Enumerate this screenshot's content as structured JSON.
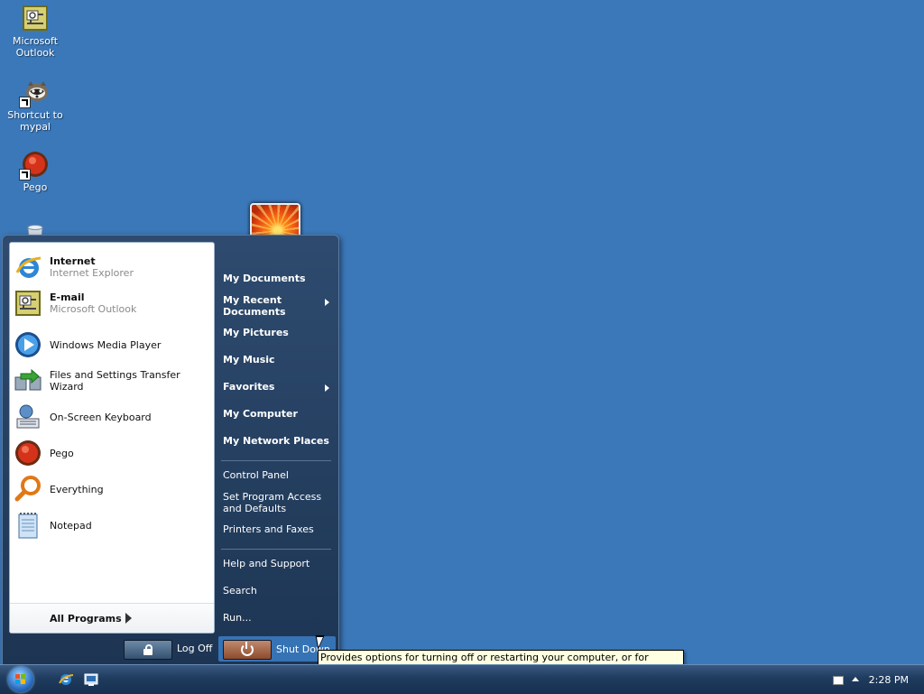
{
  "desktop": {
    "icons": [
      {
        "label": "Microsoft Outlook"
      },
      {
        "label": "Shortcut to mypal"
      },
      {
        "label": "Pego"
      }
    ]
  },
  "start_menu": {
    "pinned": [
      {
        "name": "Internet",
        "sub": "Internet Explorer"
      },
      {
        "name": "E-mail",
        "sub": "Microsoft Outlook"
      }
    ],
    "recent": [
      {
        "name": "Windows Media Player"
      },
      {
        "name": "Files and Settings Transfer Wizard"
      },
      {
        "name": "On-Screen Keyboard"
      },
      {
        "name": "Pego"
      },
      {
        "name": "Everything"
      },
      {
        "name": "Notepad"
      }
    ],
    "all_programs_label": "All Programs",
    "right_items": [
      {
        "label": "My Documents"
      },
      {
        "label": "My Recent Documents"
      },
      {
        "label": "My Pictures"
      },
      {
        "label": "My Music"
      },
      {
        "label": "Favorites"
      },
      {
        "label": "My Computer"
      },
      {
        "label": "My Network Places"
      },
      {
        "label": "Control Panel"
      },
      {
        "label": "Set Program Access and Defaults"
      },
      {
        "label": "Printers and Faxes"
      },
      {
        "label": "Help and Support"
      },
      {
        "label": "Search"
      },
      {
        "label": "Run..."
      }
    ],
    "log_off_label": "Log Off",
    "shut_down_label": "Shut Down"
  },
  "tooltip": {
    "text": "Provides options for turning off or restarting your computer, or for activating Stand By or Hibernate modes."
  },
  "taskbar": {
    "clock": "2:28 PM"
  },
  "colors": {
    "desktop": "#3b78b9",
    "start_menu": "#1d3553",
    "tooltip": "#ffffe1"
  }
}
